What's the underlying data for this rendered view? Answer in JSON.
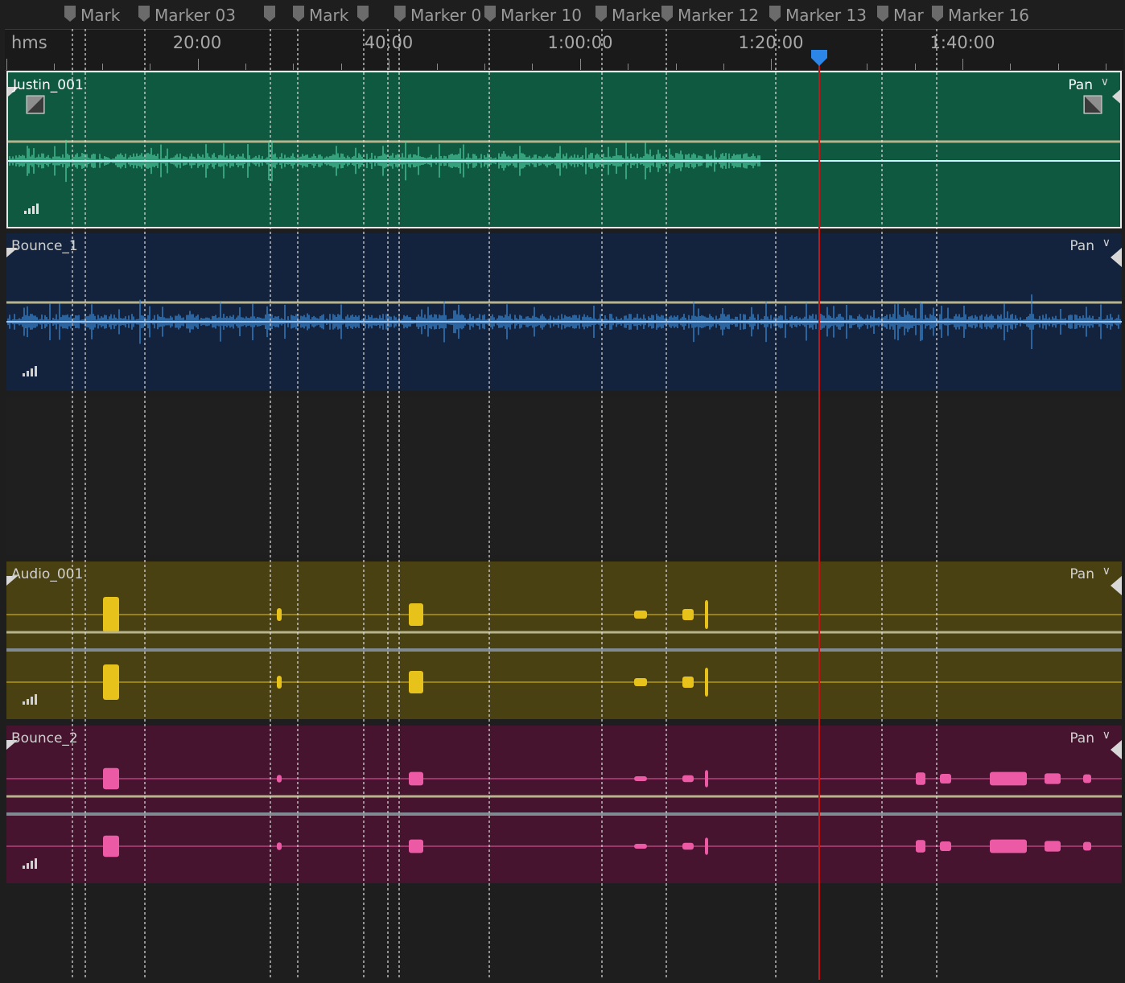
{
  "ruler": {
    "unit_label": "hms",
    "labels": [
      "20:00",
      "40:00",
      "1:00:00",
      "1:20:00",
      "1:40:00"
    ]
  },
  "markers": [
    {
      "label": "Mark"
    },
    {
      "label": "Marker 03"
    },
    {
      "label": ""
    },
    {
      "label": "Mark"
    },
    {
      "label": ""
    },
    {
      "label": "Marker 0"
    },
    {
      "label": "Marker 10"
    },
    {
      "label": "Marke"
    },
    {
      "label": "Marker 12"
    },
    {
      "label": "Marker 13"
    },
    {
      "label": "Mar"
    },
    {
      "label": "Marker 16"
    }
  ],
  "playhead": {
    "time": "1:25:00"
  },
  "tracks": [
    {
      "name": "Justin_001",
      "pan_label": "Pan",
      "color": "#0f5940",
      "wave_color": "#4fd3a6",
      "selected": true
    },
    {
      "name": "Bounce_1",
      "pan_label": "Pan",
      "color": "#13233d",
      "wave_color": "#3b8fe0",
      "selected": false
    },
    {
      "name": "Audio_001",
      "pan_label": "Pan",
      "color": "#4a4112",
      "wave_color": "#e7c21a",
      "selected": false
    },
    {
      "name": "Bounce_2",
      "pan_label": "Pan",
      "color": "#47142f",
      "wave_color": "#ec5aa6",
      "selected": false
    }
  ],
  "colors": {
    "playhead": "#c01818",
    "playhead_handle": "#2b86e8",
    "envelope": "#b7b38d"
  }
}
